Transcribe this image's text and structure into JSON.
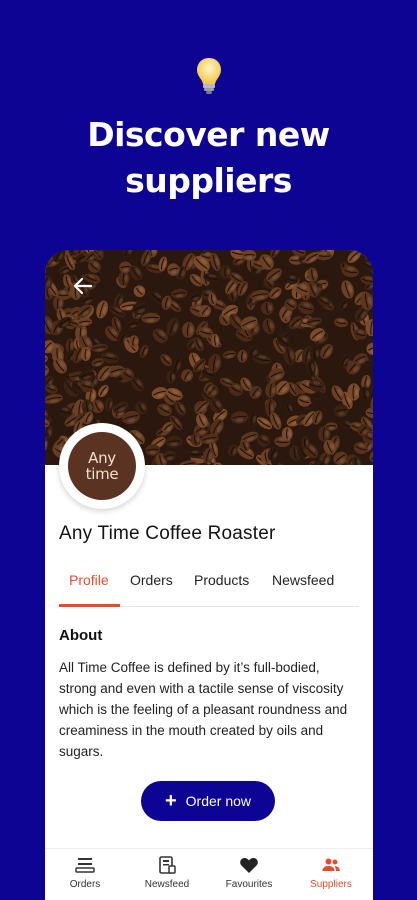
{
  "promo": {
    "headline_line1": "Discover new",
    "headline_line2": "suppliers",
    "icon": "lightbulb-icon"
  },
  "colors": {
    "background": "#0e0493",
    "accent": "#e84b2a",
    "primary_button": "#0e0493",
    "avatar_bg": "#5b3322"
  },
  "profile": {
    "back_icon": "back-arrow-icon",
    "logo_line1": "Any",
    "logo_line2": "time",
    "name": "Any Time Coffee Roaster"
  },
  "tabs": [
    {
      "label": "Profile",
      "active": true
    },
    {
      "label": "Orders",
      "active": false
    },
    {
      "label": "Products",
      "active": false
    },
    {
      "label": "Newsfeed",
      "active": false
    }
  ],
  "about": {
    "title": "About",
    "text": "All Time Coffee is defined by it’s full-bodied, strong and even with a tactile sense of viscosity which is the feeling of a pleasant roundness and creaminess in the mouth created by oils and sugars."
  },
  "order_button": {
    "label": "Order now",
    "icon": "plus-icon"
  },
  "bottom_nav": [
    {
      "label": "Orders",
      "icon": "orders-icon",
      "active": false
    },
    {
      "label": "Newsfeed",
      "icon": "newsfeed-icon",
      "active": false
    },
    {
      "label": "Favourites",
      "icon": "heart-icon",
      "active": false
    },
    {
      "label": "Suppliers",
      "icon": "suppliers-icon",
      "active": true
    }
  ]
}
